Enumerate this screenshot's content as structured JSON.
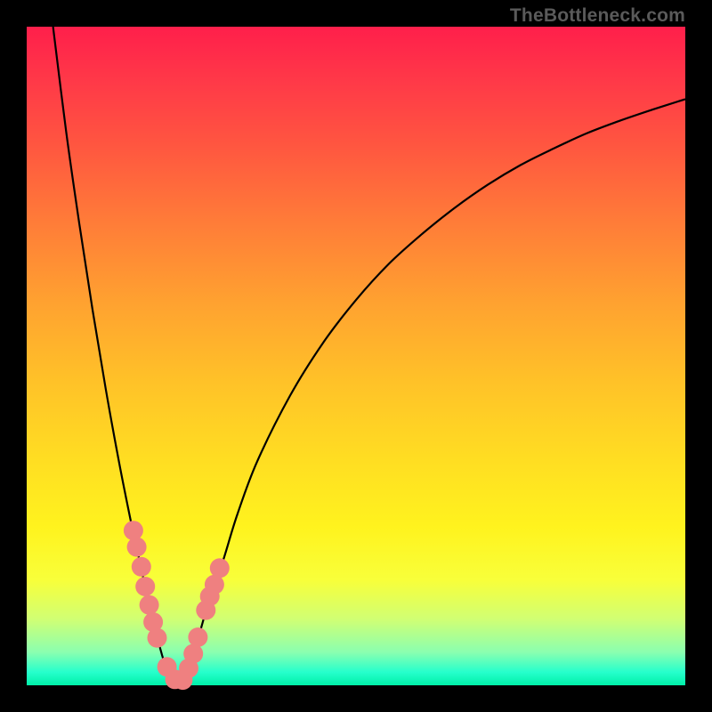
{
  "attribution": "TheBottleneck.com",
  "chart_data": {
    "type": "line",
    "title": "",
    "xlabel": "",
    "ylabel": "",
    "xlim": [
      0,
      100
    ],
    "ylim": [
      0,
      100
    ],
    "series": [
      {
        "name": "bottleneck-curve-left",
        "x": [
          4,
          6,
          8,
          10,
          12,
          14,
          16,
          17,
          18,
          19,
          19.7,
          20.3,
          21,
          22,
          23
        ],
        "y": [
          100,
          84,
          70,
          57,
          45,
          34,
          24,
          19.5,
          15,
          11,
          8,
          5.5,
          3.2,
          1.2,
          0.3
        ]
      },
      {
        "name": "bottleneck-curve-right",
        "x": [
          23,
          24,
          25,
          26,
          27,
          28.5,
          30,
          32,
          35,
          40,
          45,
          50,
          55,
          60,
          65,
          70,
          75,
          80,
          85,
          90,
          95,
          100
        ],
        "y": [
          0.3,
          1.5,
          4,
          7,
          10.5,
          15,
          19.5,
          26,
          34,
          44,
          52,
          58.5,
          64,
          68.5,
          72.5,
          76,
          79,
          81.5,
          83.8,
          85.7,
          87.4,
          89
        ]
      },
      {
        "name": "data-points-left",
        "x": [
          16.2,
          16.7,
          17.4,
          18.0,
          18.6,
          19.2,
          19.8,
          21.3,
          22.5
        ],
        "y": [
          23.5,
          21.0,
          18.0,
          15.0,
          12.2,
          9.6,
          7.2,
          2.8,
          0.9
        ]
      },
      {
        "name": "data-points-right",
        "x": [
          23.7,
          24.6,
          25.3,
          26.0,
          27.2,
          27.8,
          28.5,
          29.3
        ],
        "y": [
          0.8,
          2.6,
          4.8,
          7.3,
          11.4,
          13.5,
          15.3,
          17.8
        ]
      }
    ],
    "background": {
      "type": "vertical-gradient",
      "stops": [
        {
          "pos": 0,
          "color": "#ff1f4b"
        },
        {
          "pos": 0.5,
          "color": "#ffc228"
        },
        {
          "pos": 0.82,
          "color": "#f8ff3a"
        },
        {
          "pos": 1,
          "color": "#00f0a8"
        }
      ]
    }
  }
}
